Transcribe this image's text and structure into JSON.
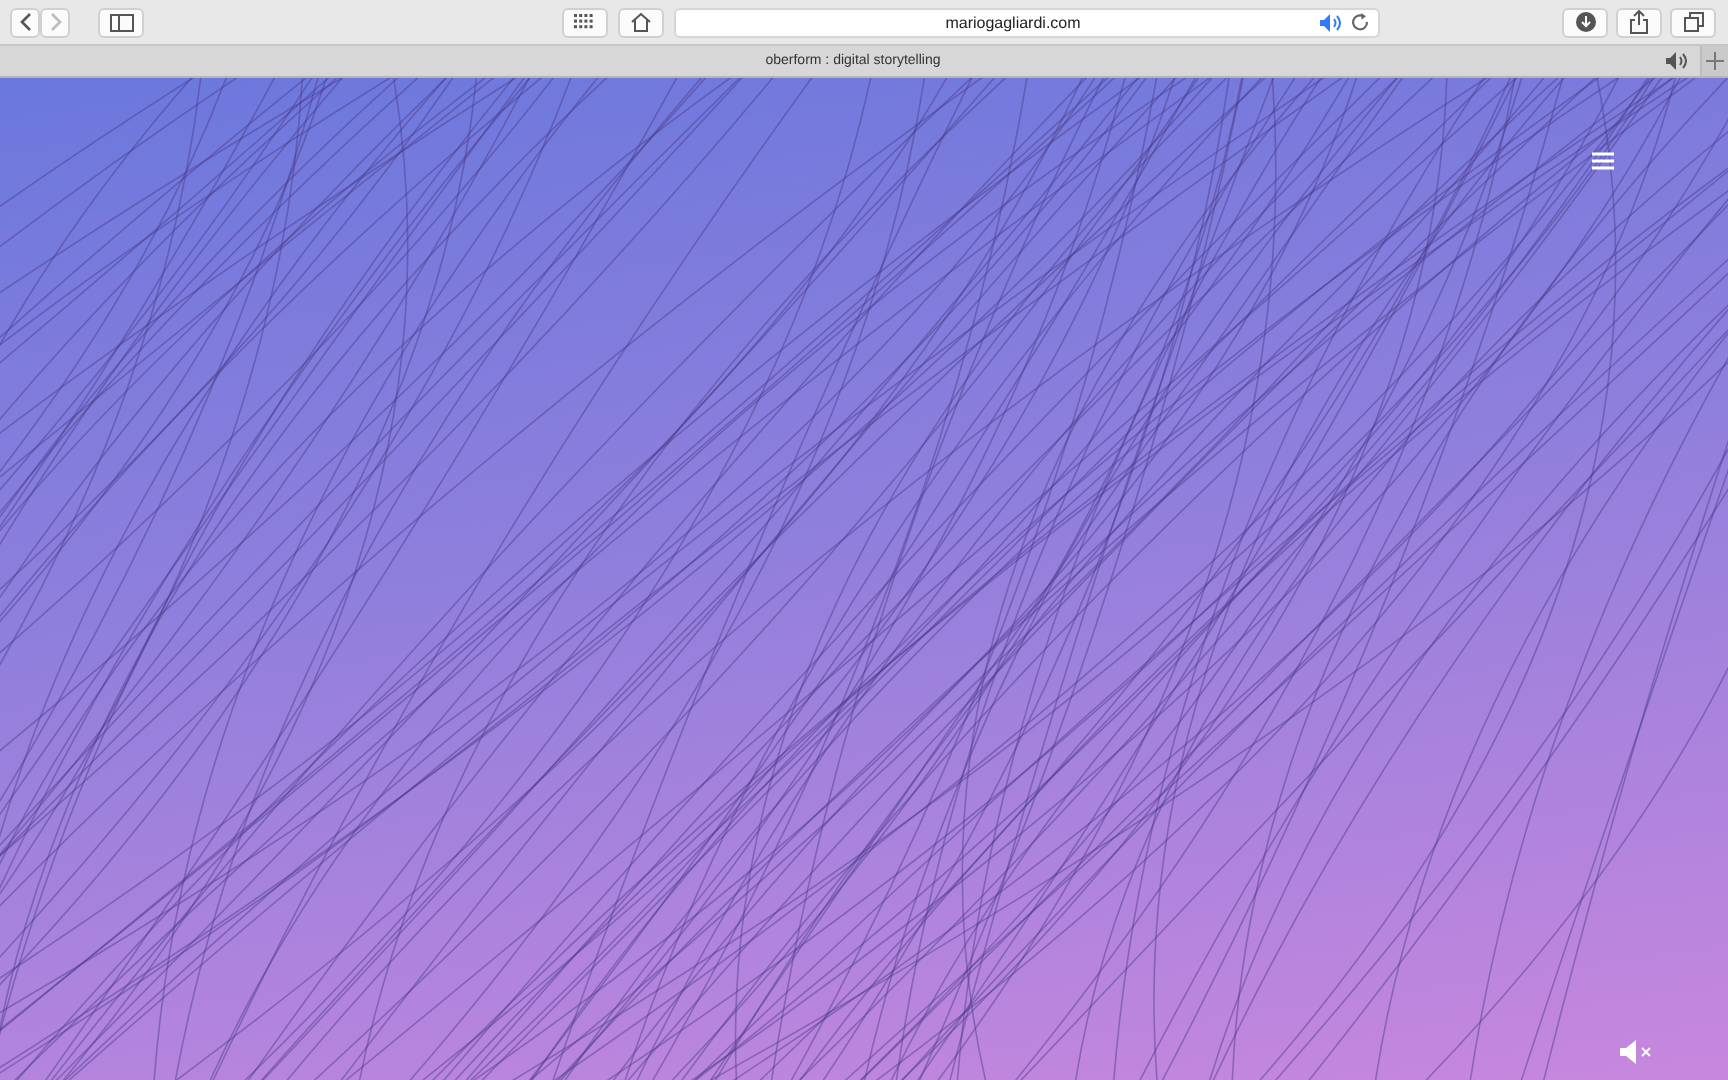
{
  "browser": {
    "address": "mariogagliardi.com",
    "tab_title": "oberform : digital storytelling"
  }
}
